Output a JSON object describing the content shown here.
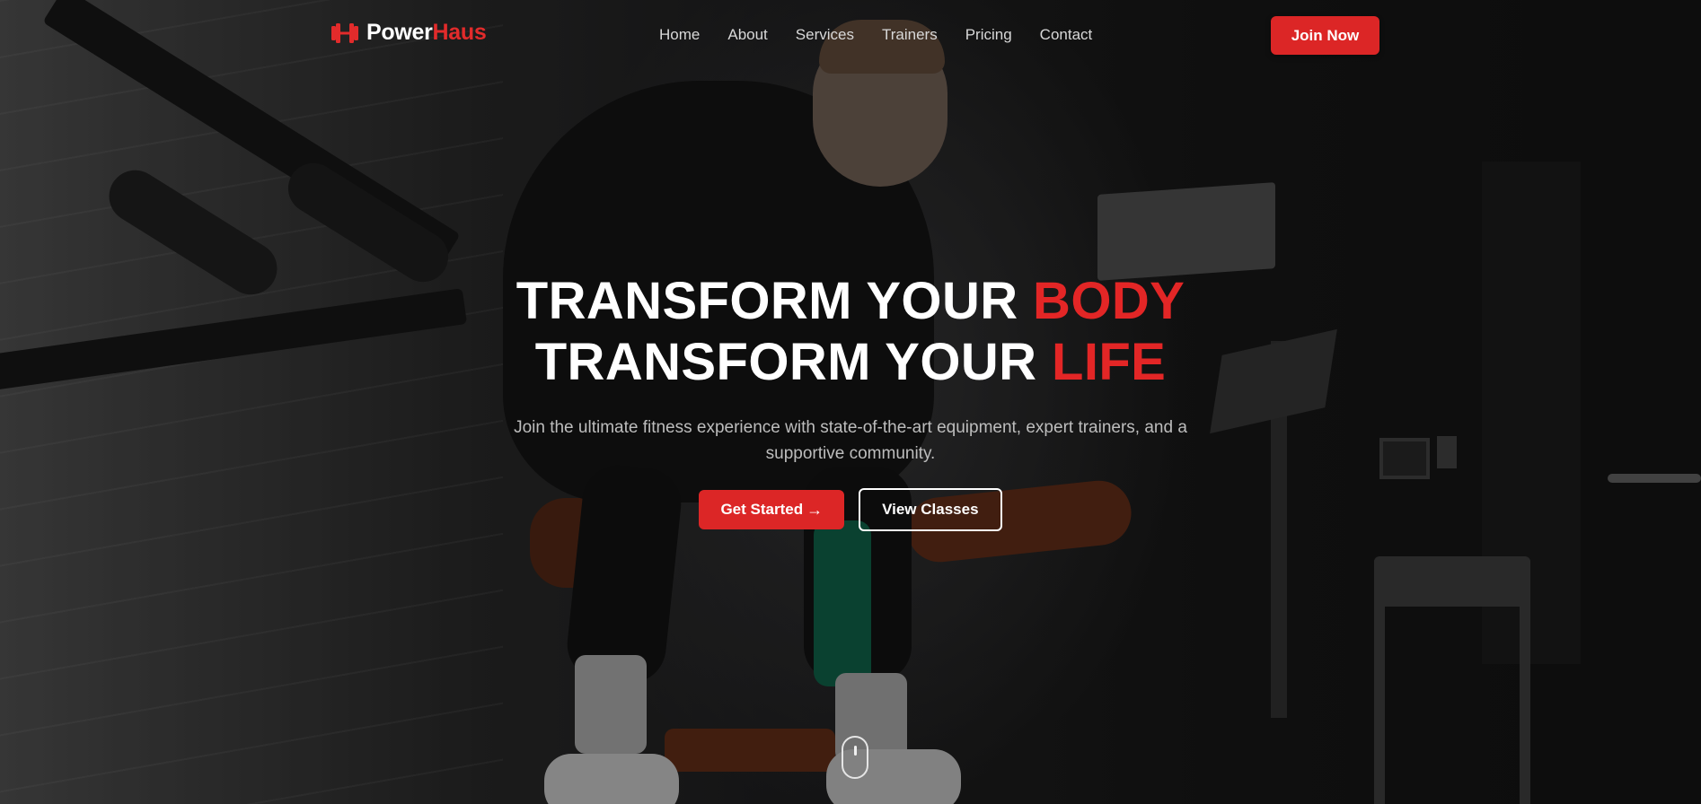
{
  "brand": {
    "name_part1": "Power",
    "name_part2": "Haus",
    "accent_color": "#dc2626",
    "logo_icon": "dumbbell-icon"
  },
  "nav": {
    "links": [
      "Home",
      "About",
      "Services",
      "Trainers",
      "Pricing",
      "Contact"
    ],
    "cta_label": "Join Now"
  },
  "hero": {
    "line1_prefix": "TRANSFORM YOUR ",
    "line1_accent": "BODY",
    "line2_prefix": "TRANSFORM YOUR ",
    "line2_accent": "LIFE",
    "subtitle": "Join the ultimate fitness experience with state-of-the-art equipment, expert trainers, and a supportive community.",
    "primary_cta": "Get Started",
    "primary_cta_icon": "arrow-right-icon",
    "secondary_cta": "View Classes",
    "scroll_icon": "mouse-scroll-icon"
  }
}
